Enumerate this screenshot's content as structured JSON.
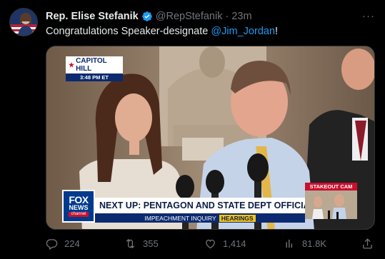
{
  "author": {
    "display_name": "Rep. Elise Stefanik",
    "handle": "@RepStefanik",
    "separator": "·",
    "time": "23m",
    "verified_color": "#1d9bf0"
  },
  "more_label": "···",
  "tweet": {
    "text_before": "Congratulations Speaker-designate ",
    "mention": "@Jim_Jordan",
    "text_after": "!"
  },
  "media": {
    "location_bug": "CAPITOL HILL",
    "location_time": "3:48 PM ET",
    "network_logo": {
      "line1": "FOX",
      "line2": "NEWS",
      "line3": "channel"
    },
    "headline": "NEXT UP: PENTAGON AND STATE DEPT OFFICIALS TESTIFY",
    "subheadline": "IMPEACHMENT INQUIRY",
    "subheadline_tag": "HEARINGS",
    "stakeout_label": "STAKEOUT CAM"
  },
  "actions": {
    "reply": {
      "icon": "reply-icon",
      "count": "224"
    },
    "retweet": {
      "icon": "retweet-icon",
      "count": "355"
    },
    "like": {
      "icon": "heart-icon",
      "count": "1,414"
    },
    "views": {
      "icon": "views-icon",
      "count": "81.8K"
    },
    "share": {
      "icon": "share-icon"
    }
  },
  "colors": {
    "background": "#000000",
    "text": "#e7e9ea",
    "muted": "#71767b",
    "link": "#1d9bf0"
  }
}
